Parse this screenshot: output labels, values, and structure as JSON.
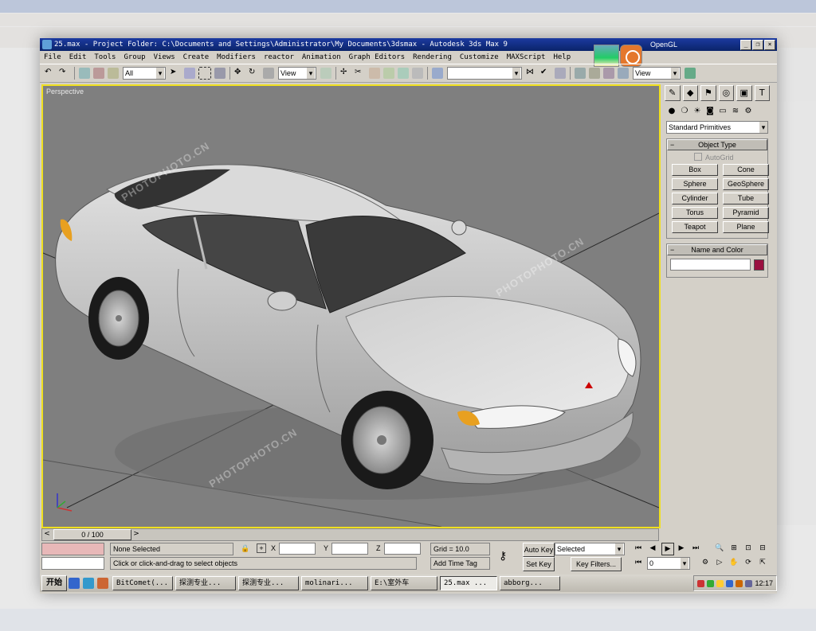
{
  "window": {
    "title": "25.max  - Project Folder: C:\\Documents and Settings\\Administrator\\My Documents\\3dsmax  - Autodesk 3ds Max 9",
    "renderer": "OpenGL"
  },
  "menu": [
    "File",
    "Edit",
    "Tools",
    "Group",
    "Views",
    "Create",
    "Modifiers",
    "reactor",
    "Animation",
    "Graph Editors",
    "Rendering",
    "Customize",
    "MAXScript",
    "Help"
  ],
  "toolbar": {
    "selection_filter": "All",
    "ref_coord": "View",
    "named_selection": "",
    "render_view": "View"
  },
  "viewport": {
    "label": "Perspective",
    "watermark_text": "PHOTOPHOTO.CN"
  },
  "command_panel": {
    "dropdown": "Standard Primitives",
    "object_type_title": "Object Type",
    "autogrid": "AutoGrid",
    "primitives": [
      "Box",
      "Cone",
      "Sphere",
      "GeoSphere",
      "Cylinder",
      "Tube",
      "Torus",
      "Pyramid",
      "Teapot",
      "Plane"
    ],
    "name_color_title": "Name and Color",
    "object_color": "#9a1040"
  },
  "time_slider": {
    "frame": "0 / 100",
    "prev": "<",
    "next": ">"
  },
  "status": {
    "selection": "None Selected",
    "prompt": "Click or click-and-drag to select objects",
    "x_label": "X",
    "y_label": "Y",
    "z_label": "Z",
    "grid": "Grid = 10.0",
    "add_time_tag": "Add Time Tag",
    "auto_key": "Auto Key",
    "set_key": "Set Key",
    "key_mode": "Selected",
    "key_filters": "Key Filters...",
    "current_frame": "0"
  },
  "taskbar": {
    "start": "开始",
    "tasks": [
      "BitComet(...",
      "探测专业...",
      "探测专业...",
      "molinari...",
      "E:\\室外车",
      "25.max ...",
      "abborg..."
    ],
    "active_index": 5,
    "clock": "12:17"
  }
}
